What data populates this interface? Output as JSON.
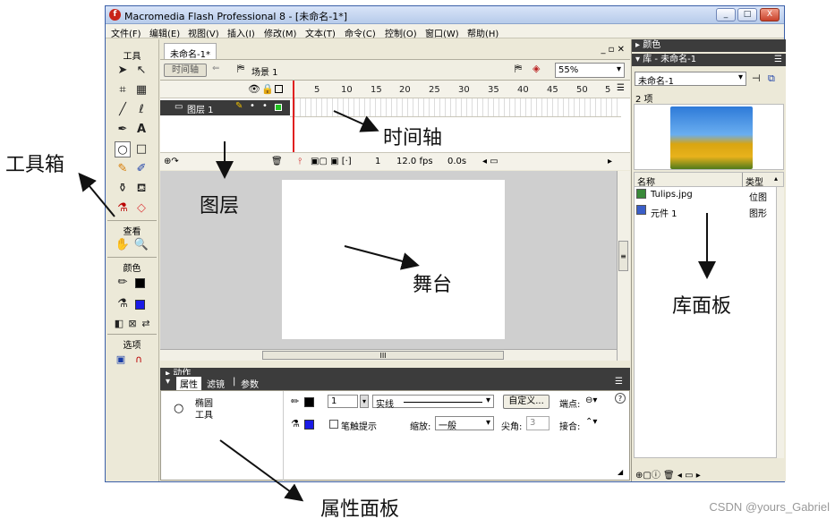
{
  "window": {
    "title": "Macromedia Flash Professional 8 - [未命名-1*]",
    "icon": "flash-icon",
    "controls": [
      "_",
      "□",
      "X"
    ]
  },
  "menu": [
    "文件(F)",
    "编辑(E)",
    "视图(V)",
    "插入(I)",
    "修改(M)",
    "文本(T)",
    "命令(C)",
    "控制(O)",
    "窗口(W)",
    "帮助(H)"
  ],
  "toolbox": {
    "title": "工具",
    "view_label": "查看",
    "colors_label": "颜色",
    "options_label": "选项"
  },
  "document": {
    "tab": "未命名-1*",
    "timeline_button": "时间轴",
    "scene": "场景 1",
    "zoom": "55%",
    "layer_name": "图层 1",
    "ruler": [
      "5",
      "10",
      "15",
      "20",
      "25",
      "30",
      "35",
      "40",
      "45",
      "50",
      "5"
    ],
    "frame": "1",
    "fps": "12.0 fps",
    "time": "0.0s",
    "scroll_glyph": "III"
  },
  "panels": {
    "actions": "动作",
    "properties_tab": "属性",
    "filters_tab": "滤镜",
    "params_tab": "参数",
    "tool_name": "椭圆\n工具",
    "stroke_width": "1",
    "stroke_style": "实线",
    "custom_button": "自定义...",
    "cap_label": "端点:",
    "hint_label": "笔触提示",
    "scale_label": "缩放:",
    "scale_value": "一般",
    "miter_label": "尖角:",
    "miter_value": "3",
    "join_label": "接合:"
  },
  "right": {
    "color_panel": "颜色",
    "library_panel": "库 - 未命名-1",
    "library_select": "未命名-1",
    "item_count": "2 项",
    "col_name": "名称",
    "col_type": "类型",
    "items": [
      {
        "name": "Tulips.jpg",
        "type": "位图"
      },
      {
        "name": "元件 1",
        "type": "图形"
      }
    ]
  },
  "annotations": {
    "toolbox": "工具箱",
    "timeline": "时间轴",
    "layers": "图层",
    "stage": "舞台",
    "library": "库面板",
    "properties": "属性面板"
  },
  "watermark": "CSDN @yours_Gabriel"
}
